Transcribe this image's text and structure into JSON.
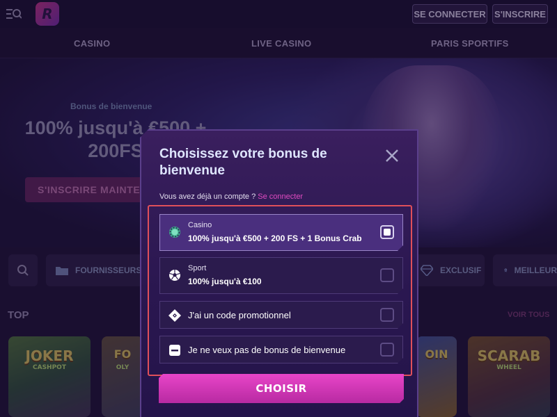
{
  "header": {
    "login_label": "SE CONNECTER",
    "register_label": "S'INSCRIRE"
  },
  "nav": {
    "casino": "CASINO",
    "live_casino": "LIVE CASINO",
    "sports": "PARIS SPORTIFS"
  },
  "hero": {
    "pretitle": "Bonus de bienvenue",
    "title": "100% jusqu'à €500 + 200FS",
    "cta": "S'INSCRIRE MAINTENANT"
  },
  "filters": {
    "providers": "FOURNISSEURS",
    "exclusive": "EXCLUSIF",
    "best": "MEILLEURS"
  },
  "section": {
    "title": "TOP",
    "see_all": "VOIR TOUS"
  },
  "games": [
    {
      "name": "JOKER",
      "sub": "CASHPOT"
    },
    {
      "name": "FO",
      "sub": "OLY"
    },
    {
      "name": "OIN",
      "sub": ""
    },
    {
      "name": "SCARAB",
      "sub": "WHEEL"
    }
  ],
  "modal": {
    "title": "Choisissez votre bonus de bienvenue",
    "account_question": "Vous avez déjà un compte ?",
    "login_link": "Se connecter",
    "options": [
      {
        "label": "Casino",
        "value": "100% jusqu'à €500 + 200 FS + 1 Bonus Crab",
        "selected": true,
        "icon": "casino-chip-icon"
      },
      {
        "label": "Sport",
        "value": "100% jusqu'à €100",
        "selected": false,
        "icon": "soccer-ball-icon"
      },
      {
        "label": "J'ai un code promotionnel",
        "selected": false,
        "icon": "promo-ticket-icon"
      },
      {
        "label": "Je ne veux pas de bonus de bienvenue",
        "selected": false,
        "icon": "no-bonus-icon"
      }
    ],
    "choose_label": "CHOISIR"
  },
  "colors": {
    "accent": "#e845c8",
    "highlight_frame": "#e0505a",
    "modal_bg": "#2a1750"
  }
}
